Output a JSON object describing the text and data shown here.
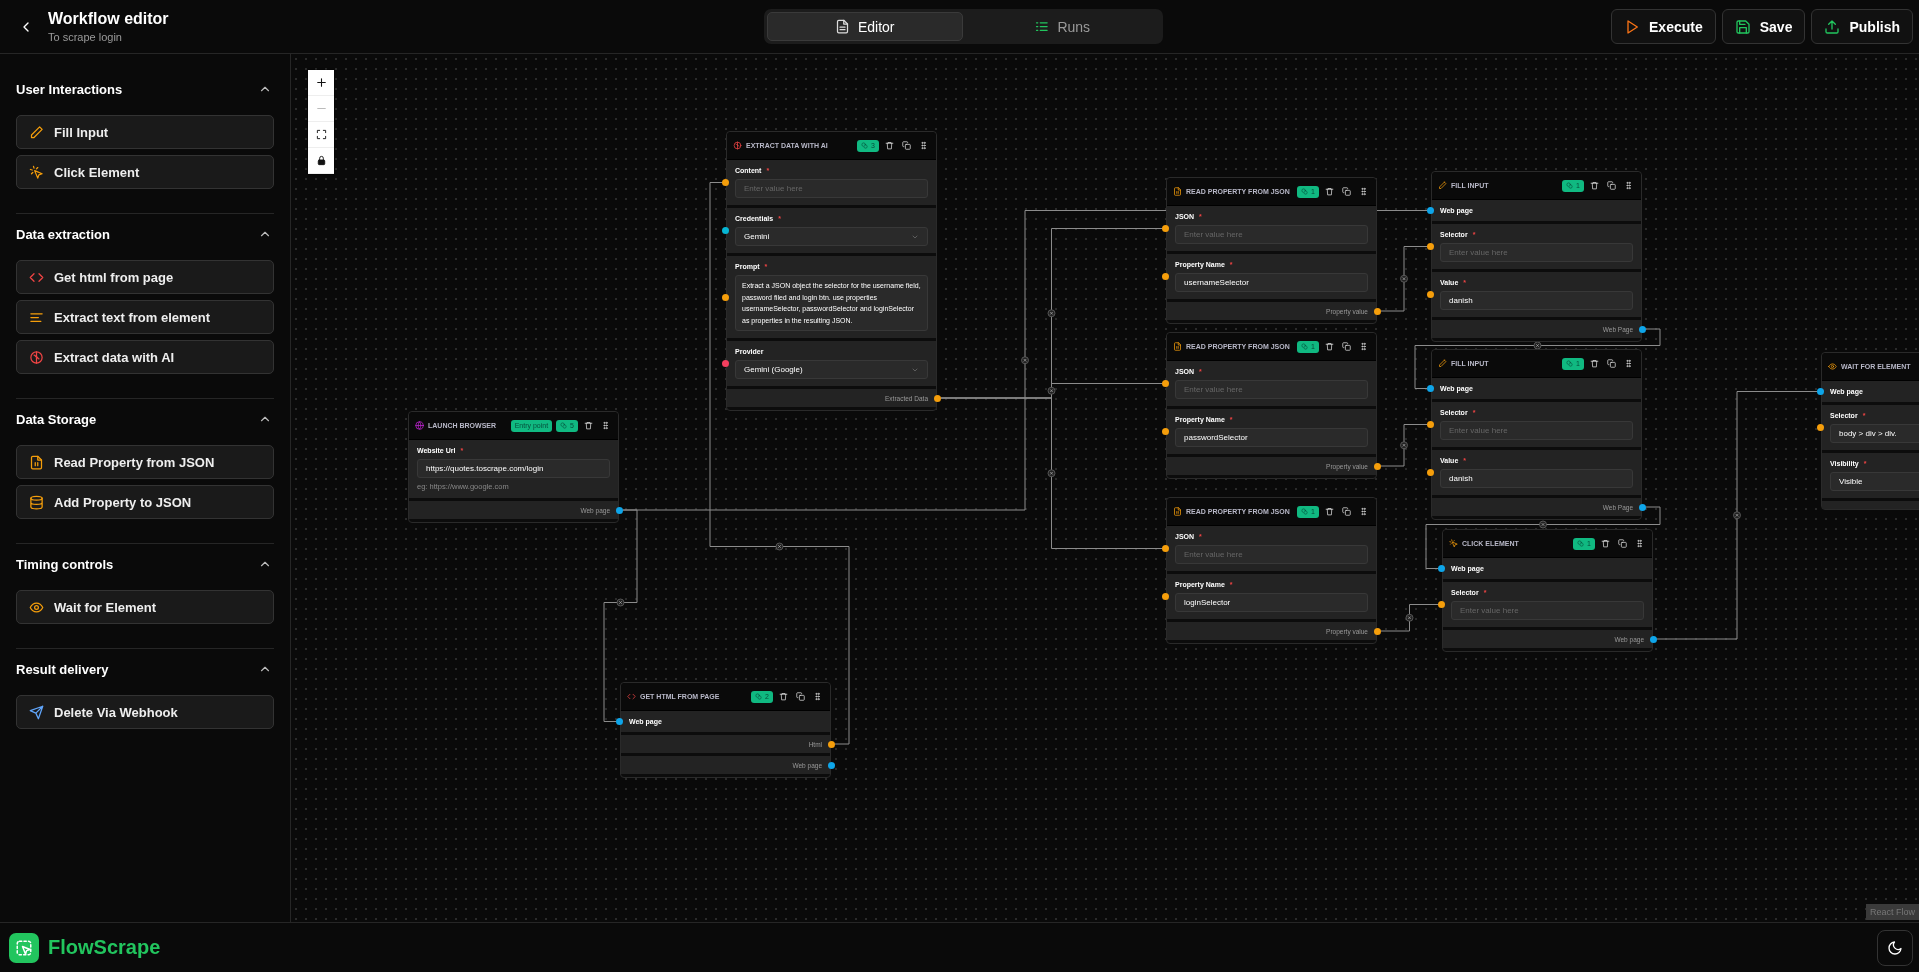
{
  "window": {
    "title": "Workflow editor",
    "subtitle": "To scrape login"
  },
  "tabs": [
    {
      "label": "Editor",
      "kind": "editor",
      "selected": true
    },
    {
      "label": "Runs",
      "kind": "runs",
      "selected": false
    }
  ],
  "actions": [
    {
      "label": "Execute",
      "kind": "execute"
    },
    {
      "label": "Save",
      "kind": "save"
    },
    {
      "label": "Publish",
      "kind": "publish"
    }
  ],
  "sidebar": {
    "sections": [
      {
        "title": "User Interactions",
        "expanded": true,
        "items": [
          {
            "label": "Fill Input",
            "kind": "fill_input"
          },
          {
            "label": "Click Element",
            "kind": "click_element"
          }
        ]
      },
      {
        "title": "Data extraction",
        "expanded": true,
        "items": [
          {
            "label": "Get html from page",
            "kind": "get_html"
          },
          {
            "label": "Extract text from element",
            "kind": "extract_text"
          },
          {
            "label": "Extract data with AI",
            "kind": "extract_ai"
          }
        ]
      },
      {
        "title": "Data Storage",
        "expanded": true,
        "items": [
          {
            "label": "Read Property from JSON",
            "kind": "read_property"
          },
          {
            "label": "Add Property to JSON",
            "kind": "add_property"
          }
        ]
      },
      {
        "title": "Timing controls",
        "expanded": true,
        "items": [
          {
            "label": "Wait for Element",
            "kind": "wait_element"
          }
        ]
      },
      {
        "title": "Result delivery",
        "expanded": true,
        "items": [
          {
            "label": "Delete Via Webhook",
            "kind": "webhook"
          }
        ]
      }
    ]
  },
  "canvas": {
    "nodes": [
      {
        "kind": "launch_browser",
        "title": "LAUNCH BROWSER",
        "entry_point": "Entry point",
        "badge": "5",
        "inputs": [
          {
            "kind": "text",
            "label": "Website Url",
            "required_mark": "*",
            "value": "https://quotes.toscrape.com/login",
            "hint": "eg: https://www.google.com"
          }
        ],
        "outputs": [
          {
            "label": "Web page",
            "color": "#0ea5e9"
          }
        ]
      },
      {
        "kind": "get_html",
        "title": "GET HTML FROM PAGE",
        "badge": "2",
        "inputs": [
          {
            "kind": "connection",
            "label": "Web page",
            "color": "#0ea5e9"
          }
        ],
        "outputs": [
          {
            "label": "Html",
            "color": "#f59e0b"
          },
          {
            "label": "Web page",
            "color": "#0ea5e9"
          }
        ]
      },
      {
        "kind": "extract_ai",
        "title": "EXTRACT DATA WITH AI",
        "badge": "3",
        "inputs": [
          {
            "kind": "text",
            "label": "Content",
            "required_mark": "*",
            "color": "#f59e0b",
            "placeholder": "Enter value here"
          },
          {
            "kind": "select",
            "label": "Credentials",
            "required_mark": "*",
            "color": "#06b6d4",
            "value": "Gemini"
          },
          {
            "kind": "textarea",
            "label": "Prompt",
            "required_mark": "*",
            "color": "#f59e0b",
            "value": "Extract a JSON object the selector for the username field, password filed and login btn. use properties usernameSelector, passwordSelector and loginSelector as properties in the resulting JSON."
          },
          {
            "kind": "select",
            "label": "Provider",
            "color": "#f43f5e",
            "value": "Gemini (Google)"
          }
        ],
        "outputs": [
          {
            "label": "Extracted Data",
            "color": "#f59e0b"
          }
        ]
      },
      {
        "kind": "read_property",
        "title": "READ PROPERTY FROM JSON",
        "badge": "1",
        "inputs": [
          {
            "kind": "text",
            "label": "JSON",
            "required_mark": "*",
            "color": "#f59e0b",
            "placeholder": "Enter value here"
          },
          {
            "kind": "text",
            "label": "Property Name",
            "required_mark": "*",
            "color": "#f59e0b",
            "value": "usernameSelector"
          }
        ],
        "outputs": [
          {
            "label": "Property value",
            "color": "#f59e0b"
          }
        ]
      },
      {
        "kind": "read_property",
        "title": "READ PROPERTY FROM JSON",
        "badge": "1",
        "inputs": [
          {
            "kind": "text",
            "label": "JSON",
            "required_mark": "*",
            "color": "#f59e0b",
            "placeholder": "Enter value here"
          },
          {
            "kind": "text",
            "label": "Property Name",
            "required_mark": "*",
            "color": "#f59e0b",
            "value": "passwordSelector"
          }
        ],
        "outputs": [
          {
            "label": "Property value",
            "color": "#f59e0b"
          }
        ]
      },
      {
        "kind": "read_property",
        "title": "READ PROPERTY FROM JSON",
        "badge": "1",
        "inputs": [
          {
            "kind": "text",
            "label": "JSON",
            "required_mark": "*",
            "color": "#f59e0b",
            "placeholder": "Enter value here"
          },
          {
            "kind": "text",
            "label": "Property Name",
            "required_mark": "*",
            "color": "#f59e0b",
            "value": "loginSelector"
          }
        ],
        "outputs": [
          {
            "label": "Property value",
            "color": "#f59e0b"
          }
        ]
      },
      {
        "kind": "fill_input",
        "title": "FILL INPUT",
        "badge": "1",
        "inputs": [
          {
            "kind": "connection",
            "label": "Web page",
            "color": "#0ea5e9"
          },
          {
            "kind": "text",
            "label": "Selector",
            "required_mark": "*",
            "color": "#f59e0b",
            "placeholder": "Enter value here"
          },
          {
            "kind": "text",
            "label": "Value",
            "required_mark": "*",
            "color": "#f59e0b",
            "value": "danish"
          }
        ],
        "outputs": [
          {
            "label": "Web Page",
            "color": "#0ea5e9"
          }
        ]
      },
      {
        "kind": "fill_input",
        "title": "FILL INPUT",
        "badge": "1",
        "inputs": [
          {
            "kind": "connection",
            "label": "Web page",
            "color": "#0ea5e9"
          },
          {
            "kind": "text",
            "label": "Selector",
            "required_mark": "*",
            "color": "#f59e0b",
            "placeholder": "Enter value here"
          },
          {
            "kind": "text",
            "label": "Value",
            "required_mark": "*",
            "color": "#f59e0b",
            "value": "danish"
          }
        ],
        "outputs": [
          {
            "label": "Web Page",
            "color": "#0ea5e9"
          }
        ]
      },
      {
        "kind": "click_element",
        "title": "CLICK ELEMENT",
        "badge": "1",
        "inputs": [
          {
            "kind": "connection",
            "label": "Web page",
            "color": "#0ea5e9"
          },
          {
            "kind": "text",
            "label": "Selector",
            "required_mark": "*",
            "color": "#f59e0b",
            "placeholder": "Enter value here"
          }
        ],
        "outputs": [
          {
            "label": "Web page",
            "color": "#0ea5e9"
          }
        ]
      },
      {
        "kind": "wait_element",
        "title": "WAIT FOR ELEMENT",
        "inputs": [
          {
            "kind": "connection",
            "label": "Web page",
            "color": "#0ea5e9"
          },
          {
            "kind": "text",
            "label": "Selector",
            "required_mark": "*",
            "color": "#f59e0b",
            "value": "body > div > div."
          },
          {
            "kind": "select",
            "label": "Visibility",
            "required_mark": "*",
            "value": "Visible"
          }
        ]
      }
    ],
    "attribution": "React Flow"
  },
  "footer": {
    "brand": "FlowScrape"
  }
}
